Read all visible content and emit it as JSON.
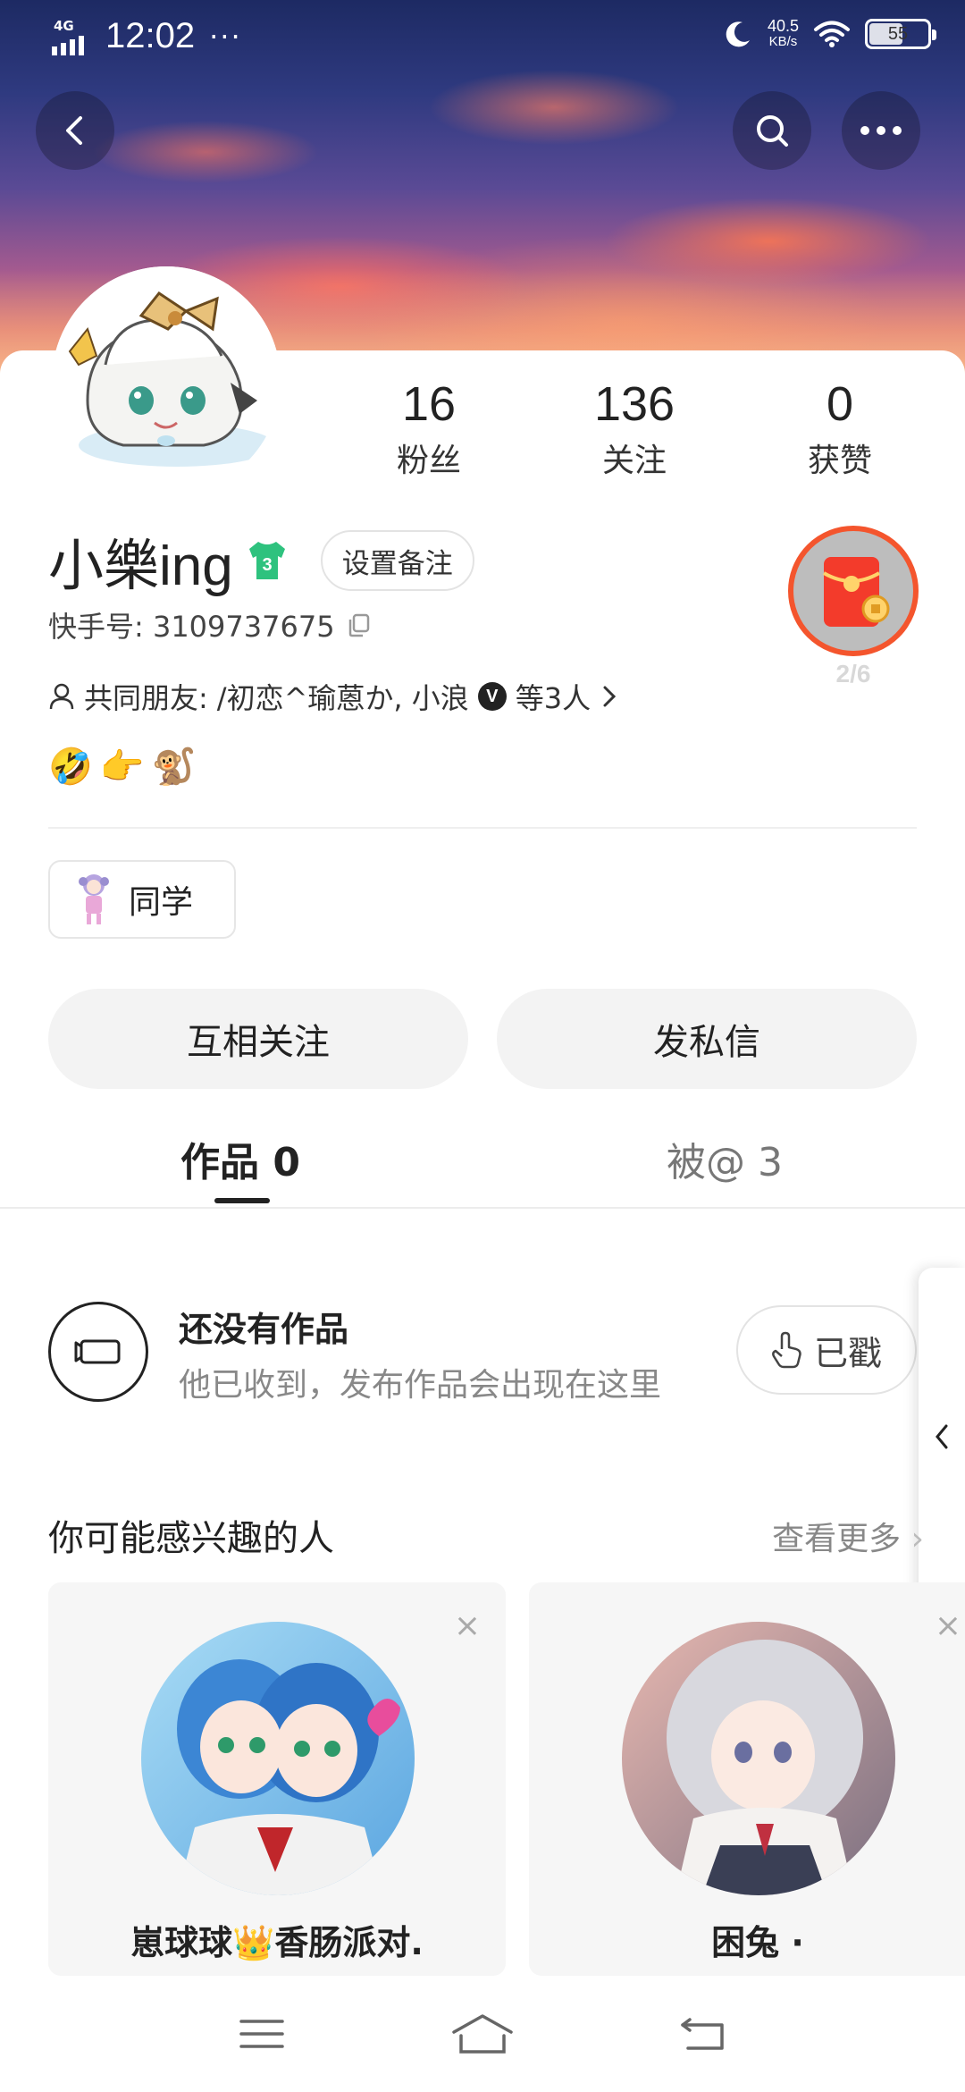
{
  "status_bar": {
    "network": "4G",
    "time": "12:02",
    "dots": "···",
    "speed_value": "40.5",
    "speed_unit": "KB/s",
    "battery": "55"
  },
  "profile": {
    "name": "小樂ing",
    "level": "3",
    "remark_label": "设置备注",
    "uid": "快手号: 3109737675",
    "friends_label": "共同朋友:",
    "friends_names": "/初恋^瑜蒽か, 小浪",
    "friends_badge": "V",
    "friends_count": "等3人",
    "emojis": [
      "🤣",
      "👉",
      "🐒"
    ],
    "redpacket_progress": "2/6"
  },
  "stats": [
    {
      "value": "16",
      "label": "粉丝"
    },
    {
      "value": "136",
      "label": "关注"
    },
    {
      "value": "0",
      "label": "获赞"
    }
  ],
  "tag": {
    "label": "同学"
  },
  "actions": {
    "follow_each_other": "互相关注",
    "message": "发私信"
  },
  "tabs": {
    "works": "作品 0",
    "mentioned": "被@ 3"
  },
  "empty_state": {
    "title": "还没有作品",
    "subtitle": "他已收到，发布作品会出现在这里",
    "poked_label": "已戳"
  },
  "recommendations": {
    "title": "你可能感兴趣的人",
    "more": "查看更多",
    "close_symbol": "×",
    "items": [
      {
        "name": "崽球球👑香肠派对.",
        "colors": [
          "#6fb8e8",
          "#2b6fc4"
        ]
      },
      {
        "name": "困兔 ·",
        "colors": [
          "#e9d6d6",
          "#6a6f8a"
        ]
      }
    ]
  }
}
